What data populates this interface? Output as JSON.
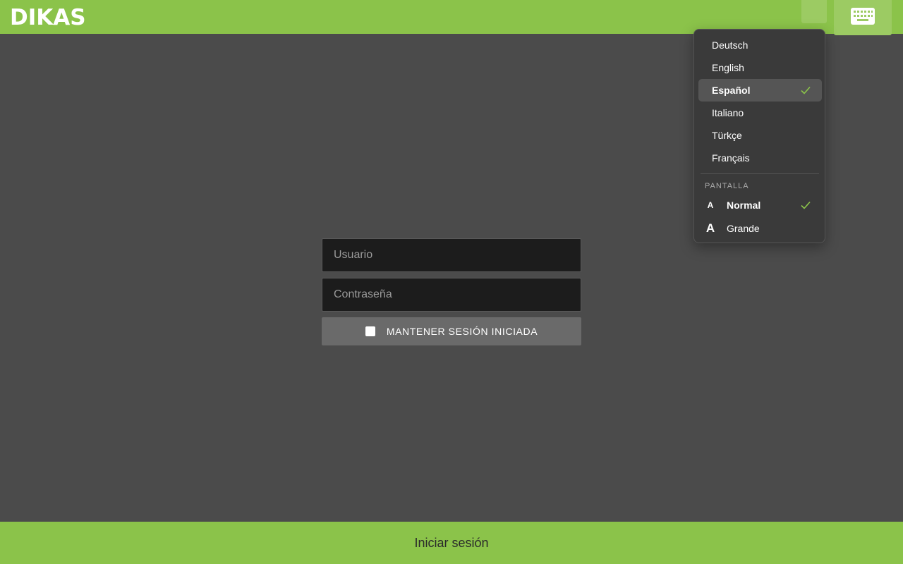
{
  "header": {
    "logo_text": "DIKAS",
    "keyboard_icon": "keyboard-icon"
  },
  "language_menu": {
    "languages": [
      {
        "label": "Deutsch",
        "selected": false
      },
      {
        "label": "English",
        "selected": false
      },
      {
        "label": "Español",
        "selected": true
      },
      {
        "label": "Italiano",
        "selected": false
      },
      {
        "label": "Türkçe",
        "selected": false
      },
      {
        "label": "Français",
        "selected": false
      }
    ],
    "display_section_label": "PANTALLA",
    "display_options": [
      {
        "glyph": "A",
        "label": "Normal",
        "selected": true
      },
      {
        "glyph": "A",
        "label": "Grande",
        "selected": false
      }
    ],
    "check_icon": "check-icon",
    "accent_color": "#8bc34a"
  },
  "login_form": {
    "username_placeholder": "Usuario",
    "password_placeholder": "Contraseña",
    "keep_session_label": "MANTENER SESIÓN INICIADA",
    "keep_session_checked": false
  },
  "footer": {
    "login_button_label": "Iniciar sesión"
  },
  "colors": {
    "brand_green": "#8bc34a",
    "background": "#4b4b4b"
  }
}
